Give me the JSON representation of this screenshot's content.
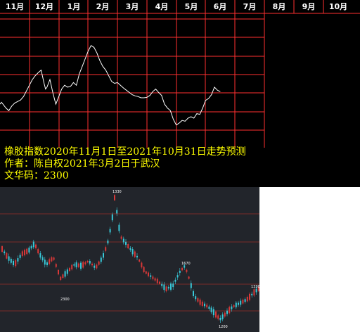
{
  "chart_data": [
    {
      "type": "line",
      "caption": [
        "橡胶指数2020年11月1日至2021年10月31日走势预测",
        "作者：陈自权2021年3月2日于武汉",
        "文华码：2300"
      ],
      "months": [
        "11月",
        "12月",
        "1月",
        "2月",
        "3月",
        "4月",
        "5月",
        "6月",
        "7月",
        "8月",
        "9月",
        "10月"
      ],
      "grid": true,
      "grid_color": "#ff3030",
      "line_color": "#ffffff",
      "x": [
        0,
        0.05,
        0.1,
        0.2,
        0.3,
        0.4,
        0.5,
        0.6,
        0.7,
        0.8,
        0.9,
        1.0,
        1.1,
        1.2,
        1.3,
        1.4,
        1.5,
        1.55,
        1.6,
        1.7,
        1.8,
        1.9,
        2.0,
        2.1,
        2.2,
        2.3,
        2.4,
        2.5,
        2.6,
        2.7,
        2.8,
        2.9,
        3.0,
        3.1,
        3.2,
        3.3,
        3.4,
        3.5,
        3.6,
        3.7,
        3.8,
        3.9,
        4.0,
        4.1,
        4.2,
        4.3,
        4.4,
        4.5,
        4.6,
        4.7,
        4.8,
        4.9,
        5.0,
        5.1,
        5.2,
        5.3,
        5.4,
        5.5,
        5.6,
        5.7,
        5.8,
        5.9,
        6.0,
        6.1,
        6.2,
        6.3,
        6.4,
        6.5,
        6.6,
        6.7,
        6.8,
        6.9,
        7.0,
        7.1,
        7.2,
        7.3,
        7.4,
        7.5
      ],
      "y": [
        0.55,
        0.6,
        0.55,
        0.45,
        0.38,
        0.5,
        0.58,
        0.62,
        0.66,
        0.75,
        0.9,
        1.05,
        1.2,
        1.3,
        1.38,
        1.45,
        1.1,
        0.95,
        1.0,
        1.2,
        0.85,
        0.55,
        0.75,
        0.95,
        1.05,
        1.0,
        1.02,
        1.12,
        1.05,
        1.35,
        1.55,
        1.75,
        1.95,
        2.1,
        2.05,
        1.9,
        1.7,
        1.55,
        1.45,
        1.3,
        1.15,
        1.1,
        1.12,
        1.05,
        0.98,
        0.92,
        0.86,
        0.8,
        0.77,
        0.75,
        0.72,
        0.72,
        0.73,
        0.78,
        0.88,
        0.95,
        0.86,
        0.78,
        0.55,
        0.45,
        0.38,
        0.15,
        0.0,
        0.05,
        0.12,
        0.1,
        0.18,
        0.22,
        0.18,
        0.3,
        0.28,
        0.45,
        0.65,
        0.7,
        0.8,
        1.0,
        0.92,
        0.88
      ],
      "xlim": [
        0,
        12
      ],
      "ylim": [
        -0.6,
        2.8
      ]
    },
    {
      "type": "candlestick",
      "up_color": "#38c8d8",
      "down_color": "#d83838",
      "grid_color": "#7a2a2a",
      "annotations": [
        "1330",
        "2300",
        "1670",
        "1200",
        "1330",
        "1330"
      ]
    }
  ]
}
